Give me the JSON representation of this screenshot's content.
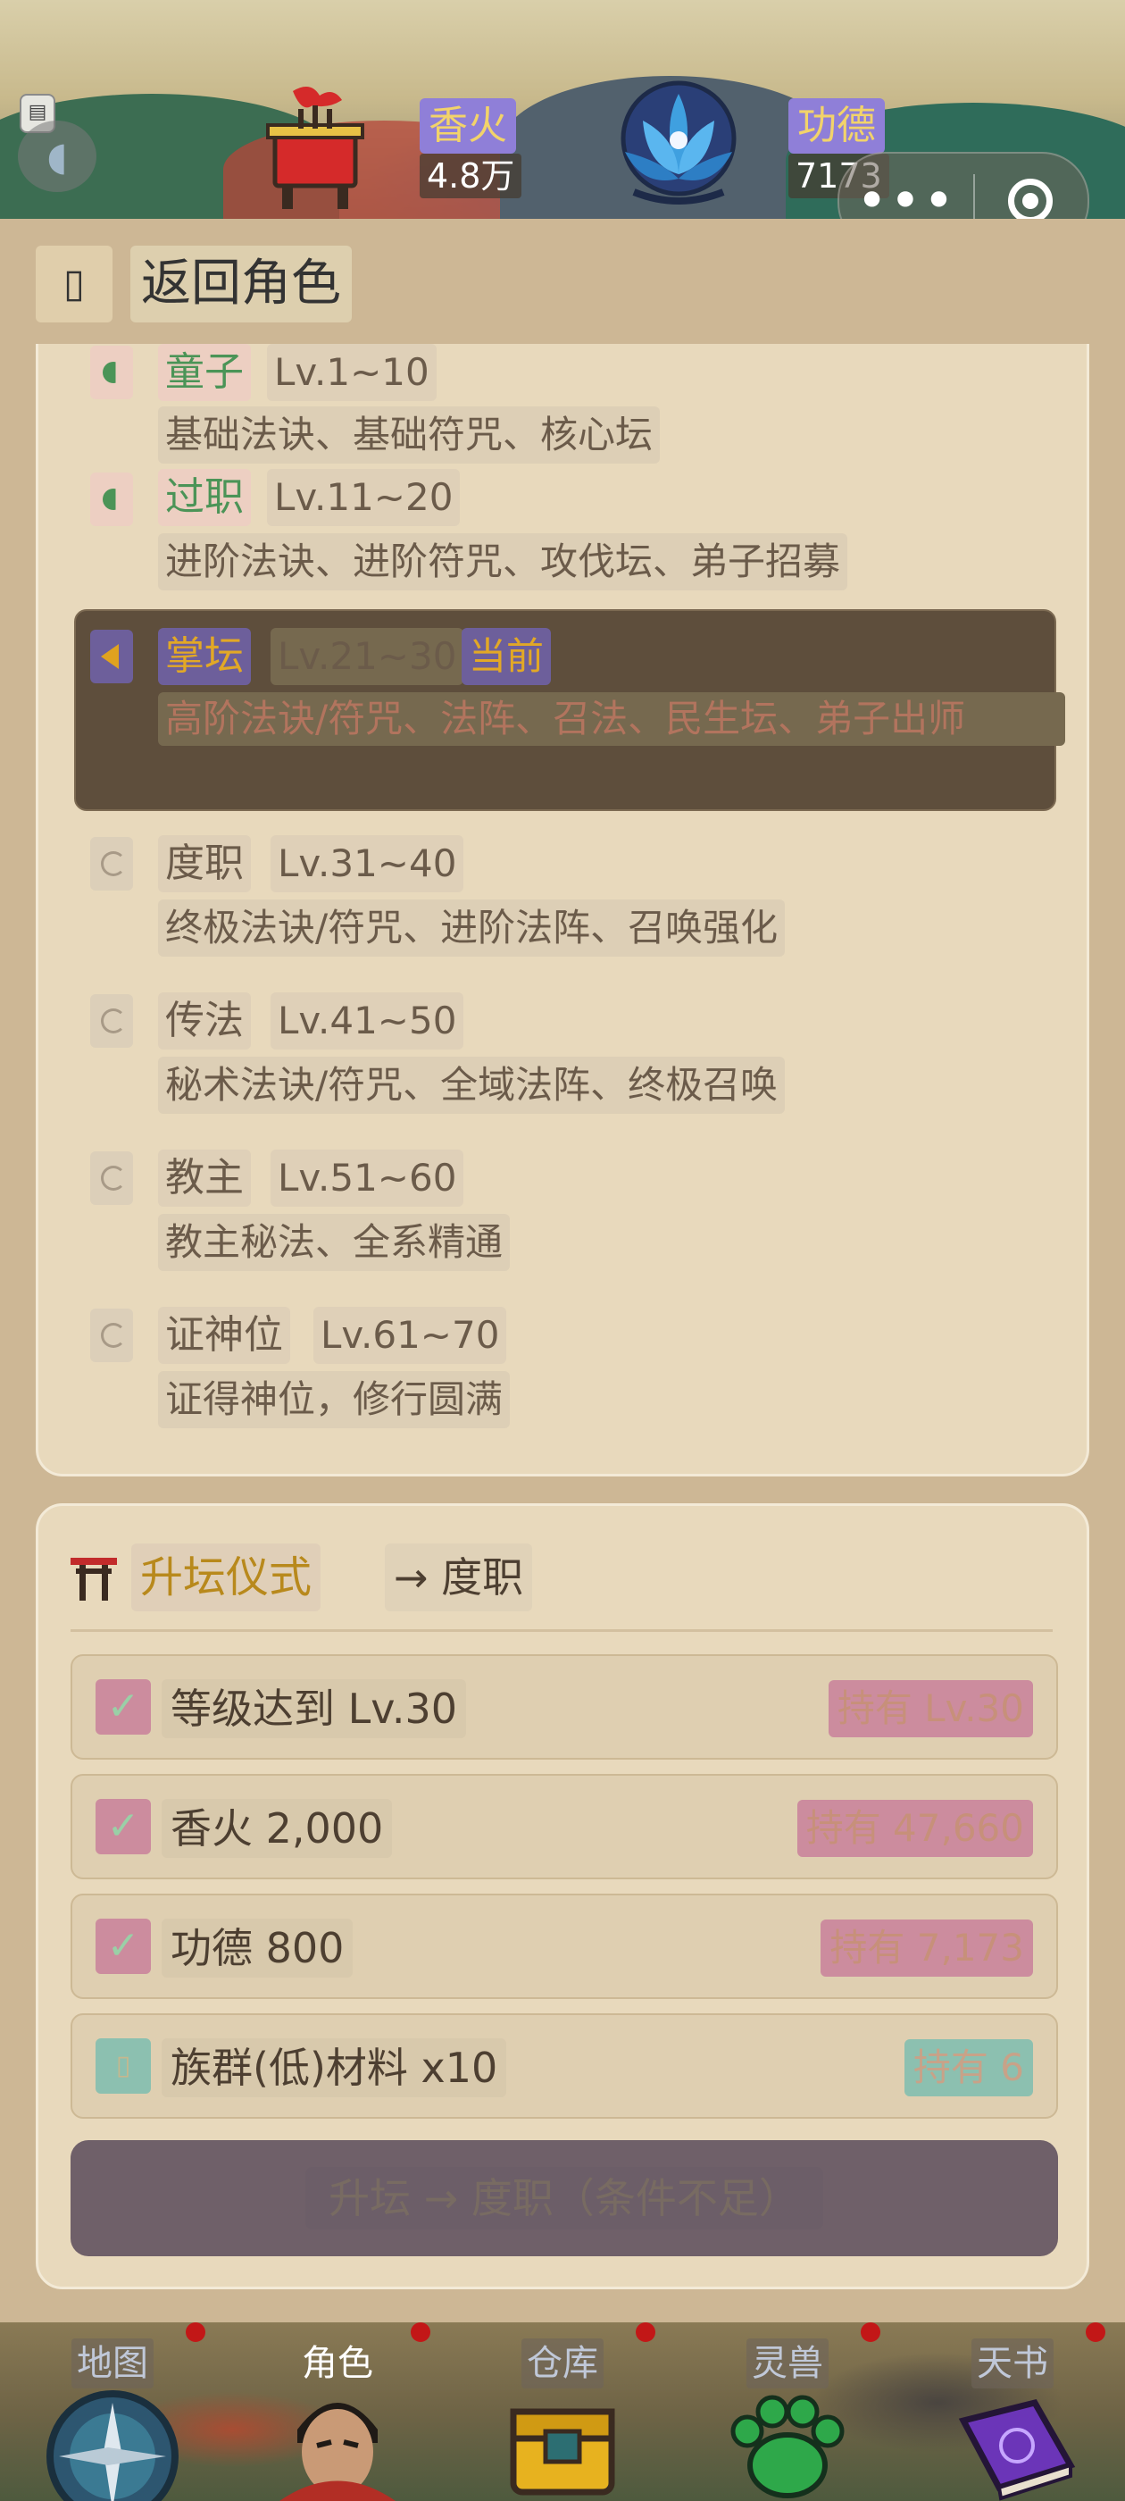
{
  "header": {
    "resources": [
      {
        "label": "香火",
        "value": "4.8万",
        "icon": "incense-burner-icon"
      },
      {
        "label": "功德",
        "value": "7173",
        "icon": "lotus-icon"
      }
    ],
    "capsule": {
      "more": "•••"
    }
  },
  "back": {
    "label": "返回角色"
  },
  "stages": [
    {
      "name": "童子",
      "level": "Lv.1~10",
      "desc": "基础法诀、基础符咒、核心坛",
      "status": "done"
    },
    {
      "name": "过职",
      "level": "Lv.11~20",
      "desc": "进阶法诀、进阶符咒、攻伐坛、弟子招募",
      "status": "done"
    },
    {
      "name": "掌坛",
      "level": "Lv.21~30",
      "tag": "当前",
      "desc": "高阶法诀/符咒、法阵、召法、民生坛、弟子出师",
      "status": "current"
    },
    {
      "name": "度职",
      "level": "Lv.31~40",
      "desc": "终极法诀/符咒、进阶法阵、召唤强化",
      "status": "locked"
    },
    {
      "name": "传法",
      "level": "Lv.41~50",
      "desc": "秘术法诀/符咒、全域法阵、终极召唤",
      "status": "locked"
    },
    {
      "name": "教主",
      "level": "Lv.51~60",
      "desc": "教主秘法、全系精通",
      "status": "locked"
    },
    {
      "name": "证神位",
      "level": "Lv.61~70",
      "desc": "证得神位，修行圆满",
      "status": "locked"
    }
  ],
  "ritual": {
    "title": "升坛仪式",
    "target": "→ 度职",
    "requirements": [
      {
        "label": "等级达到 Lv.30",
        "have": "持有 Lv.30",
        "met": true,
        "check": "✓"
      },
      {
        "label": "香火 2,000",
        "have": "持有 47,660",
        "met": true,
        "check": "✓"
      },
      {
        "label": "功德 800",
        "have": "持有 7,173",
        "met": true,
        "check": "✓"
      },
      {
        "label": "族群(低)材料 x10",
        "have": "持有 6",
        "met": false,
        "check": "▯"
      }
    ],
    "button": "升坛 → 度职（条件不足）"
  },
  "nav": [
    {
      "label": "地图",
      "icon": "compass-icon",
      "active": false
    },
    {
      "label": "角色",
      "icon": "character-portrait-icon",
      "active": true
    },
    {
      "label": "仓库",
      "icon": "treasure-chest-icon",
      "active": false
    },
    {
      "label": "灵兽",
      "icon": "paw-icon",
      "active": false
    },
    {
      "label": "天书",
      "icon": "spellbook-icon",
      "active": false
    }
  ],
  "colors": {
    "accent_gold": "#e2a826",
    "done_green": "#4b9457",
    "card_bg": "#e8d9bc",
    "badge_red": "#c21717"
  }
}
